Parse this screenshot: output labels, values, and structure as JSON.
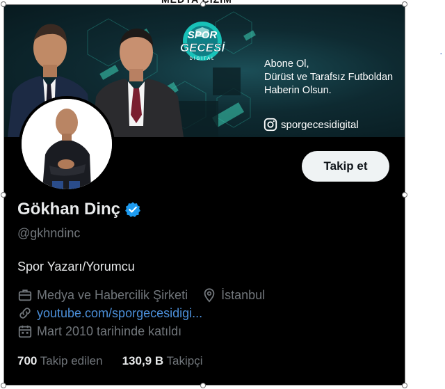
{
  "banner": {
    "logo_top": "SPOR",
    "logo_main": "GECESİ",
    "logo_sub": "DİGİTAL",
    "tagline": [
      "Abone Ol,",
      "Dürüst ve Tarafsız Futboldan",
      "Haberin Olsun."
    ],
    "instagram_handle": "sporgecesidigital"
  },
  "profile": {
    "follow_label": "Takip et",
    "name": "Gökhan Dinç",
    "handle": "@gkhndinc",
    "bio": "Spor Yazarı/Yorumcu",
    "category": "Medya ve Habercilik Şirketi",
    "location": "İstanbul",
    "website": "youtube.com/sporgecesidigi...",
    "joined": "Mart 2010 tarihinde katıldı",
    "following_count": "700",
    "following_label": "Takip edilen",
    "followers_count": "130,9 B",
    "followers_label": "Takipçi"
  },
  "colors": {
    "background": "#000000",
    "text_primary": "#e7e9ea",
    "text_secondary": "#71767b",
    "link": "#4b8fd9",
    "verified": "#1d9bf0",
    "follow_button": "#eff3f4"
  },
  "icons": [
    "verified-badge-icon",
    "briefcase-icon",
    "location-pin-icon",
    "link-icon",
    "calendar-icon",
    "instagram-icon"
  ]
}
